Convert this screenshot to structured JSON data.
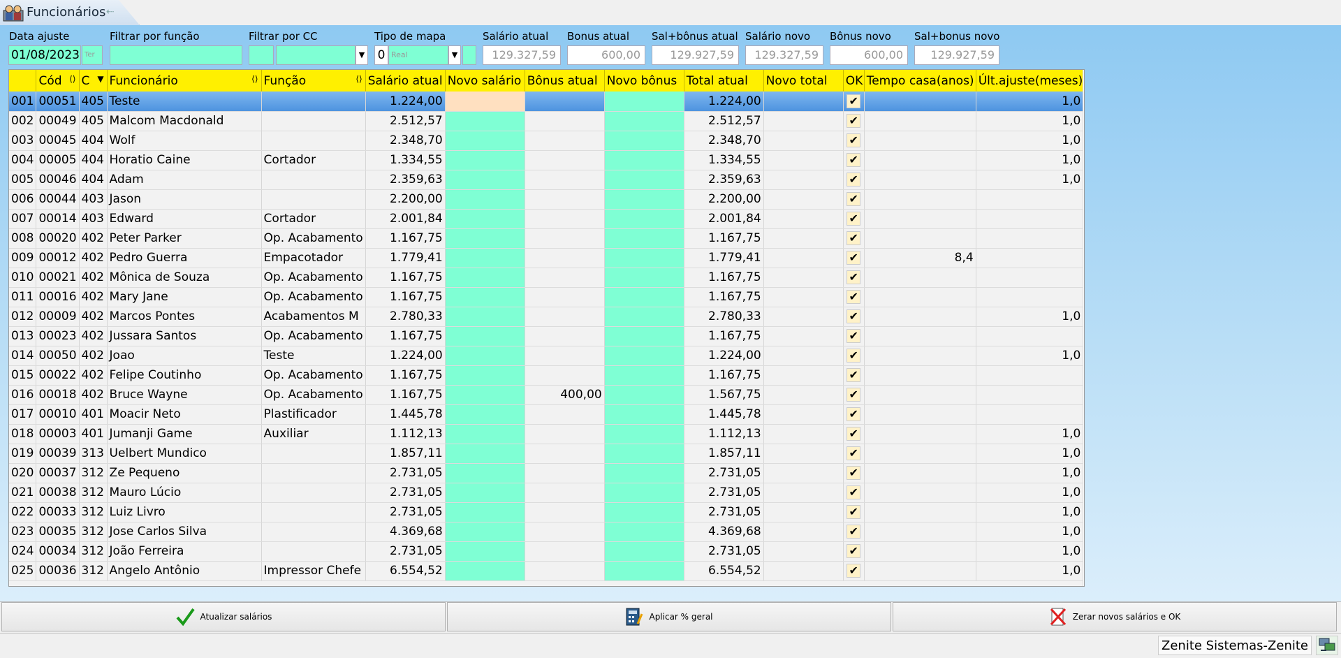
{
  "window": {
    "title": "Funcionários",
    "pin_icon": "arrow-left-icon"
  },
  "filters": {
    "data_ajuste_label": "Data ajuste",
    "data_ajuste_value": "01/08/2023",
    "data_ajuste_day": "Ter",
    "funcao_label": "Filtrar por função",
    "funcao_value": "",
    "cc_label": "Filtrar por CC",
    "cc_value": "",
    "tipo_mapa_label": "Tipo de mapa",
    "tipo_mapa_code": "0",
    "tipo_mapa_value": "Real",
    "salario_atual_label": "Salário atual",
    "salario_atual_value": "129.327,59",
    "bonus_atual_label": "Bonus atual",
    "bonus_atual_value": "600,00",
    "sal_bonus_atual_label": "Sal+bônus atual",
    "sal_bonus_atual_value": "129.927,59",
    "salario_novo_label": "Salário novo",
    "salario_novo_value": "129.327,59",
    "bonus_novo_label": "Bônus novo",
    "bonus_novo_value": "600,00",
    "sal_bonus_novo_label": "Sal+bonus novo",
    "sal_bonus_novo_value": "129.927,59"
  },
  "grid": {
    "headers": [
      "",
      "Cód",
      "C",
      "Funcionário",
      "Função",
      "Salário atual",
      "Novo salário",
      "Bônus atual",
      "Novo bônus",
      "Total atual",
      "Novo total",
      "OK",
      "Tempo casa(anos)",
      "Últ.ajuste(meses)"
    ],
    "rows": [
      [
        "001",
        "00051",
        "405",
        "Teste",
        "",
        "1.224,00",
        "",
        "",
        "",
        "1.224,00",
        "",
        "✔",
        "",
        "1,0"
      ],
      [
        "002",
        "00049",
        "405",
        "Malcom Macdonald",
        "",
        "2.512,57",
        "",
        "",
        "",
        "2.512,57",
        "",
        "✔",
        "",
        "1,0"
      ],
      [
        "003",
        "00045",
        "404",
        "Wolf",
        "",
        "2.348,70",
        "",
        "",
        "",
        "2.348,70",
        "",
        "✔",
        "",
        "1,0"
      ],
      [
        "004",
        "00005",
        "404",
        "Horatio Caine",
        "Cortador",
        "1.334,55",
        "",
        "",
        "",
        "1.334,55",
        "",
        "✔",
        "",
        "1,0"
      ],
      [
        "005",
        "00046",
        "404",
        "Adam",
        "",
        "2.359,63",
        "",
        "",
        "",
        "2.359,63",
        "",
        "✔",
        "",
        "1,0"
      ],
      [
        "006",
        "00044",
        "403",
        "Jason",
        "",
        "2.200,00",
        "",
        "",
        "",
        "2.200,00",
        "",
        "✔",
        "",
        ""
      ],
      [
        "007",
        "00014",
        "403",
        "Edward",
        "Cortador",
        "2.001,84",
        "",
        "",
        "",
        "2.001,84",
        "",
        "✔",
        "",
        ""
      ],
      [
        "008",
        "00020",
        "402",
        "Peter Parker",
        "Op. Acabamento",
        "1.167,75",
        "",
        "",
        "",
        "1.167,75",
        "",
        "✔",
        "",
        ""
      ],
      [
        "009",
        "00012",
        "402",
        "Pedro Guerra",
        "Empacotador",
        "1.779,41",
        "",
        "",
        "",
        "1.779,41",
        "",
        "✔",
        "8,4",
        ""
      ],
      [
        "010",
        "00021",
        "402",
        "Mônica de Souza",
        "Op. Acabamento",
        "1.167,75",
        "",
        "",
        "",
        "1.167,75",
        "",
        "✔",
        "",
        ""
      ],
      [
        "011",
        "00016",
        "402",
        "Mary Jane",
        "Op. Acabamento",
        "1.167,75",
        "",
        "",
        "",
        "1.167,75",
        "",
        "✔",
        "",
        ""
      ],
      [
        "012",
        "00009",
        "402",
        "Marcos Pontes",
        "Acabamentos M",
        "2.780,33",
        "",
        "",
        "",
        "2.780,33",
        "",
        "✔",
        "",
        "1,0"
      ],
      [
        "013",
        "00023",
        "402",
        "Jussara Santos",
        "Op. Acabamento",
        "1.167,75",
        "",
        "",
        "",
        "1.167,75",
        "",
        "✔",
        "",
        ""
      ],
      [
        "014",
        "00050",
        "402",
        "Joao",
        "Teste",
        "1.224,00",
        "",
        "",
        "",
        "1.224,00",
        "",
        "✔",
        "",
        "1,0"
      ],
      [
        "015",
        "00022",
        "402",
        "Felipe Coutinho",
        "Op. Acabamento",
        "1.167,75",
        "",
        "",
        "",
        "1.167,75",
        "",
        "✔",
        "",
        ""
      ],
      [
        "016",
        "00018",
        "402",
        "Bruce Wayne",
        "Op. Acabamento",
        "1.167,75",
        "",
        "400,00",
        "",
        "1.567,75",
        "",
        "✔",
        "",
        ""
      ],
      [
        "017",
        "00010",
        "401",
        "Moacir Neto",
        "Plastificador",
        "1.445,78",
        "",
        "",
        "",
        "1.445,78",
        "",
        "✔",
        "",
        ""
      ],
      [
        "018",
        "00003",
        "401",
        "Jumanji Game",
        "Auxiliar",
        "1.112,13",
        "",
        "",
        "",
        "1.112,13",
        "",
        "✔",
        "",
        "1,0"
      ],
      [
        "019",
        "00039",
        "313",
        "Uelbert Mundico",
        "",
        "1.857,11",
        "",
        "",
        "",
        "1.857,11",
        "",
        "✔",
        "",
        "1,0"
      ],
      [
        "020",
        "00037",
        "312",
        "Ze Pequeno",
        "",
        "2.731,05",
        "",
        "",
        "",
        "2.731,05",
        "",
        "✔",
        "",
        "1,0"
      ],
      [
        "021",
        "00038",
        "312",
        "Mauro Lúcio",
        "",
        "2.731,05",
        "",
        "",
        "",
        "2.731,05",
        "",
        "✔",
        "",
        "1,0"
      ],
      [
        "022",
        "00033",
        "312",
        "Luiz Livro",
        "",
        "2.731,05",
        "",
        "",
        "",
        "2.731,05",
        "",
        "✔",
        "",
        "1,0"
      ],
      [
        "023",
        "00035",
        "312",
        "Jose Carlos Silva",
        "",
        "4.369,68",
        "",
        "",
        "",
        "4.369,68",
        "",
        "✔",
        "",
        "1,0"
      ],
      [
        "024",
        "00034",
        "312",
        "João Ferreira",
        "",
        "2.731,05",
        "",
        "",
        "",
        "2.731,05",
        "",
        "✔",
        "",
        "1,0"
      ],
      [
        "025",
        "00036",
        "312",
        "Angelo Antônio",
        "Impressor Chefe",
        "6.554,52",
        "",
        "",
        "",
        "6.554,52",
        "",
        "✔",
        "",
        "1,0"
      ]
    ]
  },
  "buttons": {
    "atualizar": "Atualizar salários",
    "aplicar": "Aplicar % geral",
    "zerar": "Zerar novos salários e OK"
  },
  "status": {
    "text": "Zenite Sistemas-Zenite"
  },
  "colors": {
    "header": "#fff000",
    "editable": "#7fffd4",
    "selected": "#4e93df"
  }
}
